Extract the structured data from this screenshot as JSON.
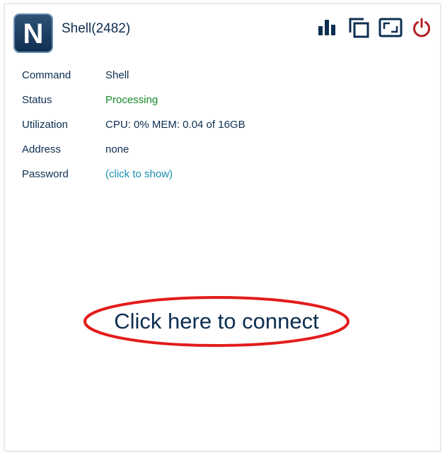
{
  "app": {
    "icon_letter": "N",
    "title": "Shell(2482)"
  },
  "toolbar": {
    "icons": [
      "bar-chart-icon",
      "copy-icon",
      "resize-icon",
      "power-icon"
    ],
    "power_color": "#b32024",
    "icon_color": "#0c2e50"
  },
  "details": {
    "rows": [
      {
        "label": "Command",
        "value": "Shell"
      },
      {
        "label": "Status",
        "value": "Processing"
      },
      {
        "label": "Utilization",
        "value": "CPU: 0% MEM: 0.04 of 16GB"
      },
      {
        "label": "Address",
        "value": "none"
      },
      {
        "label": "Password",
        "value": "(click to show)"
      }
    ]
  },
  "connect": {
    "label": "Click here to connect",
    "highlight_color": "#e31b1b"
  },
  "colors": {
    "text": "#0c2e50",
    "status": "#188a2a",
    "link": "#1a8fb0"
  }
}
